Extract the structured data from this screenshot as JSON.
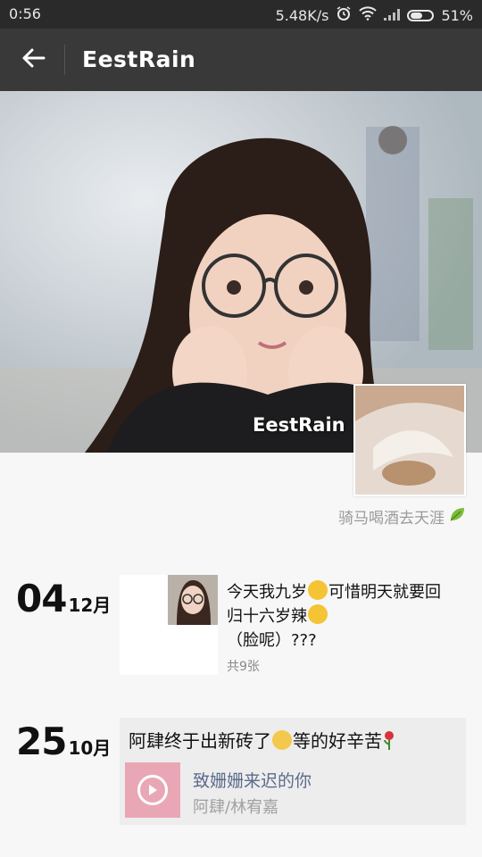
{
  "status": {
    "time": "0:56",
    "speed": "5.48K/s",
    "battery": "51%"
  },
  "appbar": {
    "title": "EestRain"
  },
  "cover": {
    "name": "EestRain"
  },
  "profile": {
    "signature": "骑马喝酒去天涯"
  },
  "posts": [
    {
      "day": "04",
      "month": "12月",
      "text_line1": "今天我九岁",
      "text_line1b": "可惜明天就要回",
      "text_line2": "归十六岁辣",
      "text_line3": "（脸呢）???",
      "count": "共9张"
    },
    {
      "day": "25",
      "month": "10月",
      "text_a": "阿肆终于出新砖了",
      "text_b": "等的好辛苦",
      "song": "致姗姗来迟的你",
      "artist": "阿肆/林宥嘉"
    }
  ],
  "colors": {
    "appbar": "#393939",
    "statusbar": "#2a2a2a",
    "link": "#5b6b8c"
  },
  "icons": [
    "back-arrow-icon",
    "alarm-icon",
    "wifi-icon",
    "signal-icon",
    "battery-icon",
    "leaf-icon",
    "play-icon",
    "grin-emoji-icon",
    "dizzy-emoji-icon",
    "cry-emoji-icon",
    "rose-icon"
  ]
}
